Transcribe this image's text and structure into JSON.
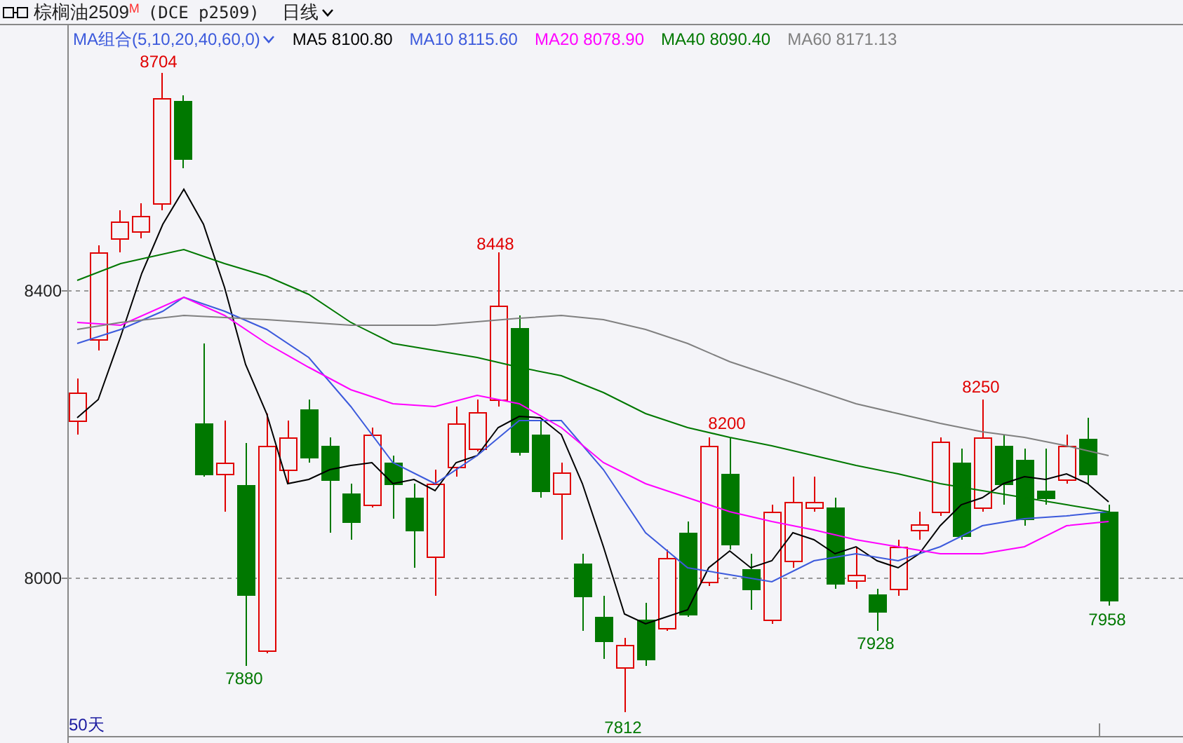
{
  "header": {
    "title": "棕榈油2509",
    "badge": "M",
    "code": "(DCE p2509)",
    "period": "日线"
  },
  "legend": {
    "selector": "MA组合(5,10,20,40,60,0)",
    "items": [
      {
        "label": "MA5 8100.80",
        "color": "#000000"
      },
      {
        "label": "MA10 8115.60",
        "color": "#3c5adc"
      },
      {
        "label": "MA20 8078.90",
        "color": "#ff00ff"
      },
      {
        "label": "MA40 8090.40",
        "color": "#007800"
      },
      {
        "label": "MA60 8171.13",
        "color": "#808080"
      }
    ]
  },
  "y_axis": {
    "ticks": [
      "8400",
      "8000"
    ]
  },
  "price_labels": [
    {
      "text": "8704",
      "kind": "high"
    },
    {
      "text": "8448",
      "kind": "high"
    },
    {
      "text": "8200",
      "kind": "high"
    },
    {
      "text": "8250",
      "kind": "high"
    },
    {
      "text": "7880",
      "kind": "low"
    },
    {
      "text": "7812",
      "kind": "low"
    },
    {
      "text": "7928",
      "kind": "low"
    },
    {
      "text": "7958",
      "kind": "low"
    }
  ],
  "range_label": "50天"
}
